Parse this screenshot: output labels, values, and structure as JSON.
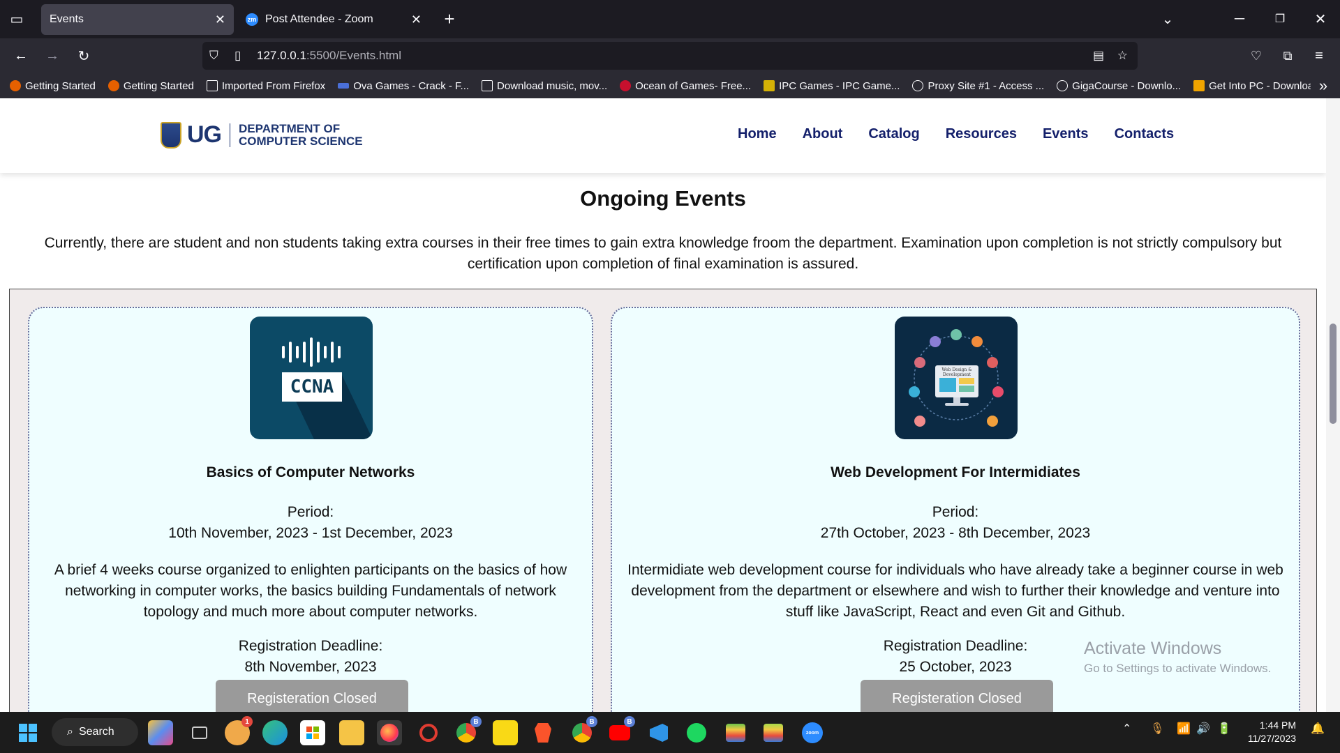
{
  "browser": {
    "tabs": [
      {
        "title": "Events",
        "active": true
      },
      {
        "title": "Post Attendee - Zoom",
        "active": false
      }
    ],
    "zoom_badge": "zm",
    "url": {
      "host": "127.0.0.1",
      "path": ":5500/Events.html"
    },
    "bookmarks": [
      {
        "label": "Getting Started",
        "icon": "firefox-icon"
      },
      {
        "label": "Getting Started",
        "icon": "firefox-icon"
      },
      {
        "label": "Imported From Firefox",
        "icon": "folder-icon"
      },
      {
        "label": "Ova Games - Crack - F...",
        "icon": "ova-icon"
      },
      {
        "label": "Download music, mov...",
        "icon": "download-icon"
      },
      {
        "label": "Ocean of Games- Free...",
        "icon": "ocean-icon"
      },
      {
        "label": "IPC Games - IPC Game...",
        "icon": "ipc-icon"
      },
      {
        "label": "Proxy Site #1 - Access ...",
        "icon": "globe-icon"
      },
      {
        "label": "GigaCourse - Downlo...",
        "icon": "globe-icon"
      },
      {
        "label": "Get Into PC - Downloa...",
        "icon": "getintopc-icon"
      }
    ]
  },
  "site": {
    "logo": {
      "short": "UG",
      "dept_line1": "DEPARTMENT OF",
      "dept_line2": "COMPUTER SCIENCE"
    },
    "nav": [
      "Home",
      "About",
      "Catalog",
      "Resources",
      "Events",
      "Contacts"
    ]
  },
  "events": {
    "title": "Ongoing Events",
    "intro": "Currently, there are student and non students taking extra courses in their free times to gain extra knowledge froom the department. Examination upon completion is not strictly compulsory but certification upon completion of final examination is assured.",
    "cards": [
      {
        "image_text": "CCNA",
        "title": "Basics of Computer Networks",
        "period_label": "Period:",
        "period": "10th November, 2023 - 1st December, 2023",
        "description": "A brief 4 weeks course organized to enlighten participants on the basics of how networking in computer works, the basics building Fundamentals of network topology and much more about computer networks.",
        "deadline_label": "Registration Deadline:",
        "deadline": "8th November, 2023",
        "button": "Registeration Closed"
      },
      {
        "image_text": "Web Design & Development",
        "title": "Web Development For Intermidiates",
        "period_label": "Period:",
        "period": "27th October, 2023 - 8th December, 2023",
        "description": "Intermidiate web development course for individuals who have already take a beginner course in web development from the department or elsewhere and wish to further their knowledge and venture into stuff like JavaScript, React and even Git and Github.",
        "deadline_label": "Registration Deadline:",
        "deadline": "25 October, 2023",
        "button": "Registeration Closed"
      }
    ]
  },
  "watermark": {
    "line1": "Activate Windows",
    "line2": "Go to Settings to activate Windows."
  },
  "taskbar": {
    "search_label": "Search",
    "notification_count": "1",
    "badge_b": "B",
    "zoom_label": "zoom",
    "time": "1:44 PM",
    "date": "11/27/2023"
  }
}
